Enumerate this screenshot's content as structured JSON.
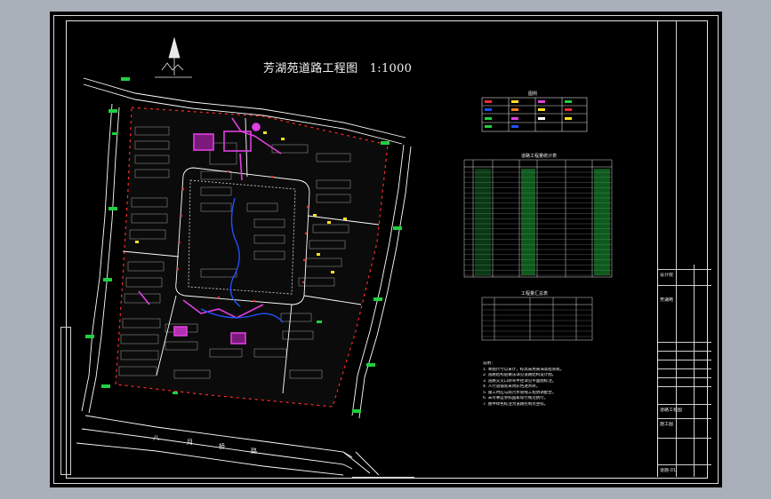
{
  "drawing": {
    "title": "芳湖苑道路工程图",
    "scale": "1:1000",
    "south_road": [
      "八",
      "月",
      "桥",
      "路"
    ]
  },
  "tables": {
    "legend_caption": "图例",
    "road_table_caption": "道路工程量统计表",
    "summary_table_caption": "工程量汇总表"
  },
  "notes": {
    "heading": "说明：",
    "lines": [
      "1. 本图尺寸以米计，标高采用黄海高程系统。",
      "2. 道路结构层做法详见道路结构设计图。",
      "3. 道路交叉口转弯半径详见平面图标注。",
      "4. 人行道铺装采用彩色透水砖。",
      "5. 施工时应与雨污水管线工程协调配合。",
      "6. 未尽事宜参照国家现行规范执行。",
      "7. 图中绿色标注为道路控制点坐标。"
    ]
  },
  "title_block": {
    "company": "设计院",
    "project": "芳湖苑",
    "drawing_name": "道路工程图",
    "stage": "施工图",
    "sheet": "道施-01"
  },
  "colors": {
    "background": "#000000",
    "app_bg": "#a9b0b9",
    "frame": "#e6e6e6",
    "road_edge": "#ffffff",
    "kerb_marker": "#ff2a2a",
    "magenta": "#e040e0",
    "green_label": "#20d040",
    "yellow": "#ffe020",
    "blue": "#2050ff",
    "building": "#7a7a7a"
  }
}
